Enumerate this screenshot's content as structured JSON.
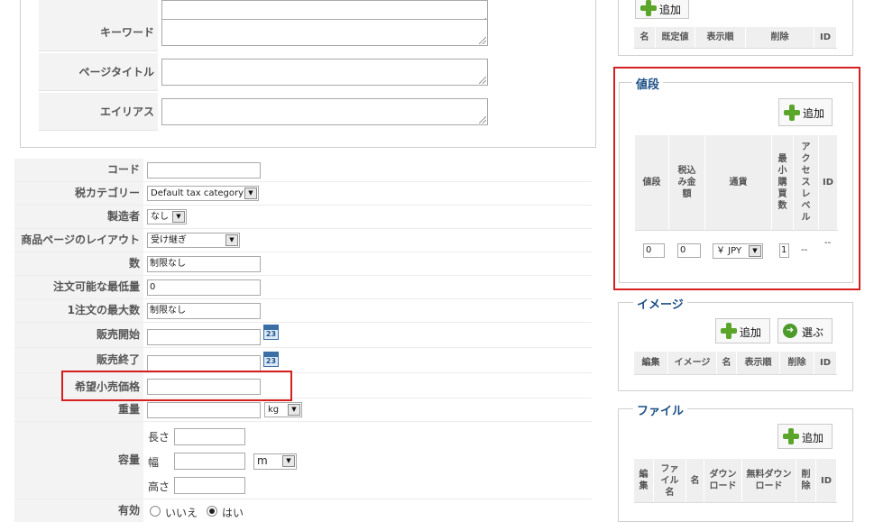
{
  "meta": {
    "rows": [
      {
        "label": "キーワード"
      },
      {
        "label": "ページタイトル"
      },
      {
        "label": "エイリアス"
      }
    ]
  },
  "form": {
    "code_label": "コード",
    "tax_label": "税カテゴリー",
    "tax_value": "Default tax category",
    "manufacturer_label": "製造者",
    "manufacturer_value": "なし",
    "layout_label": "商品ページのレイアウト",
    "layout_value": "受け継ぎ",
    "quantity_label": "数",
    "quantity_value": "制限なし",
    "min_order_label": "注文可能な最低量",
    "min_order_value": "0",
    "max_order_label": "1注文の最大数",
    "max_order_value": "制限なし",
    "sale_start_label": "販売開始",
    "sale_end_label": "販売終了",
    "msrp_label": "希望小売価格",
    "weight_label": "重量",
    "weight_unit": "kg",
    "volume_label": "容量",
    "length_label": "長さ",
    "width_label": "幅",
    "height_label": "高さ",
    "volume_unit": "m",
    "enabled_label": "有効",
    "enabled_no": "いいえ",
    "enabled_yes": "はい",
    "calendar_text": "23"
  },
  "attributes": {
    "add_label": "追加",
    "columns": [
      "名",
      "既定値",
      "表示順",
      "削除",
      "ID"
    ]
  },
  "prices": {
    "legend": "値段",
    "add_label": "追加",
    "columns": [
      "値段",
      "税込み金額",
      "通貨",
      "最小購買数",
      "アクセスレベル",
      "ID"
    ],
    "row": {
      "price": "0",
      "tax_price": "0",
      "currency": "￥ JPY",
      "min_qty": "1",
      "access": "--",
      "id": "--"
    }
  },
  "images": {
    "legend": "イメージ",
    "add_label": "追加",
    "select_label": "選ぶ",
    "columns": [
      "編集",
      "イメージ",
      "名",
      "表示順",
      "削除",
      "ID"
    ]
  },
  "files": {
    "legend": "ファイル",
    "add_label": "追加",
    "columns": [
      "編集",
      "ファイル名",
      "名",
      "ダウンロード",
      "無料ダウンロード",
      "削除",
      "ID"
    ]
  },
  "colors": {
    "highlight": "#d62020",
    "legend": "#1b4f86",
    "add_icon": "#5aa52a"
  }
}
